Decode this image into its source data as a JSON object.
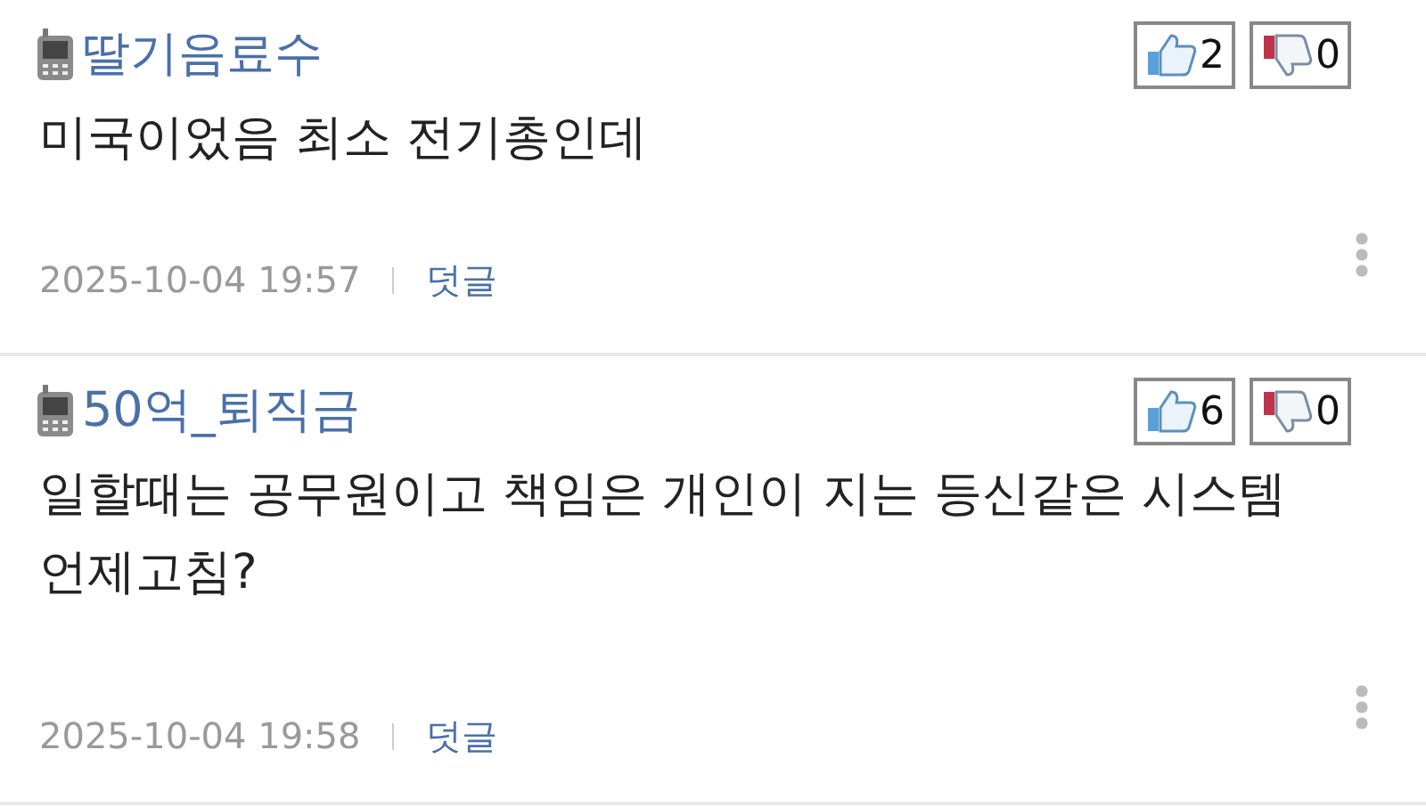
{
  "comments": [
    {
      "author": "딸기음료수",
      "text": "미국이었음 최소 전기총인데",
      "date": "2025-10-04 19:57",
      "reply": "덧글",
      "likes": "2",
      "dislikes": "0"
    },
    {
      "author": "50억_퇴직금",
      "text": "일할때는 공무원이고 책임은 개인이 지는 등신같은 시스템 언제고침?",
      "date": "2025-10-04 19:58",
      "reply": "덧글",
      "likes": "6",
      "dislikes": "0"
    }
  ]
}
